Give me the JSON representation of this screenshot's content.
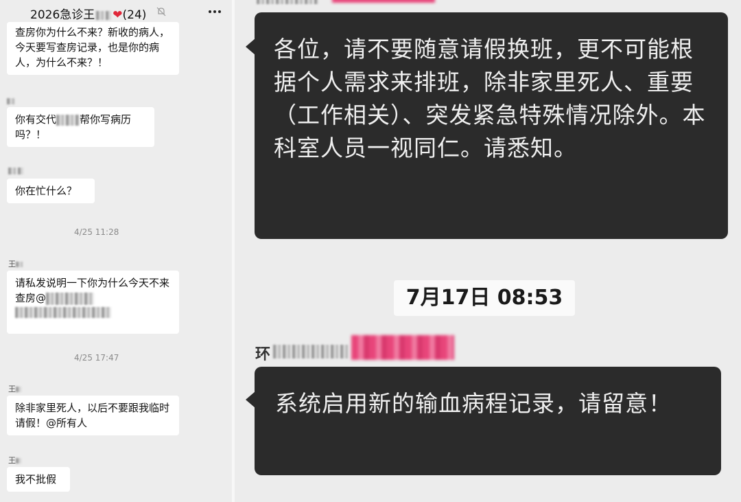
{
  "left_panel": {
    "title": {
      "group_name": "2026急诊王",
      "heart": "❤",
      "member_count": "(24)"
    },
    "messages": [
      {
        "sender": "",
        "text": "查房你为什么不来？新收的病人，今天要写查房记录，也是你的病人，为什么不来？！"
      },
      {
        "sender": "",
        "text_before": "你有交代",
        "text_after": "帮你写病历吗？！"
      },
      {
        "sender": "",
        "text": "你在忙什么？"
      },
      {
        "sender": "王",
        "text": "请私发说明一下你为什么今天不来查房@"
      },
      {
        "sender": "王",
        "text": "除非家里死人，以后不要跟我临时请假！@所有人"
      },
      {
        "sender": "王",
        "text": "我不批假"
      }
    ],
    "timestamps": [
      "4/25 11:28",
      "4/25 17:47"
    ]
  },
  "right_panel": {
    "messages": [
      {
        "text": "各位，请不要随意请假换班，更不可能根据个人需求来排班，除非家里死人、重要（工作相关）、突发紧急特殊情况除外。本科室人员一视同仁。请悉知。"
      },
      {
        "text": "系统启用新的输血病程记录，请留意！"
      }
    ],
    "timestamp": "7月17日 08:53",
    "sender_initial": "环"
  },
  "icons": {
    "mute": "mute-bell-icon",
    "more": "more-options-icon"
  },
  "colors": {
    "dark_bubble": "#2b2b2b",
    "light_bubble": "#ffffff",
    "background": "#ededed",
    "heart": "#e0283a",
    "redaction_pink": "#e8457a"
  }
}
